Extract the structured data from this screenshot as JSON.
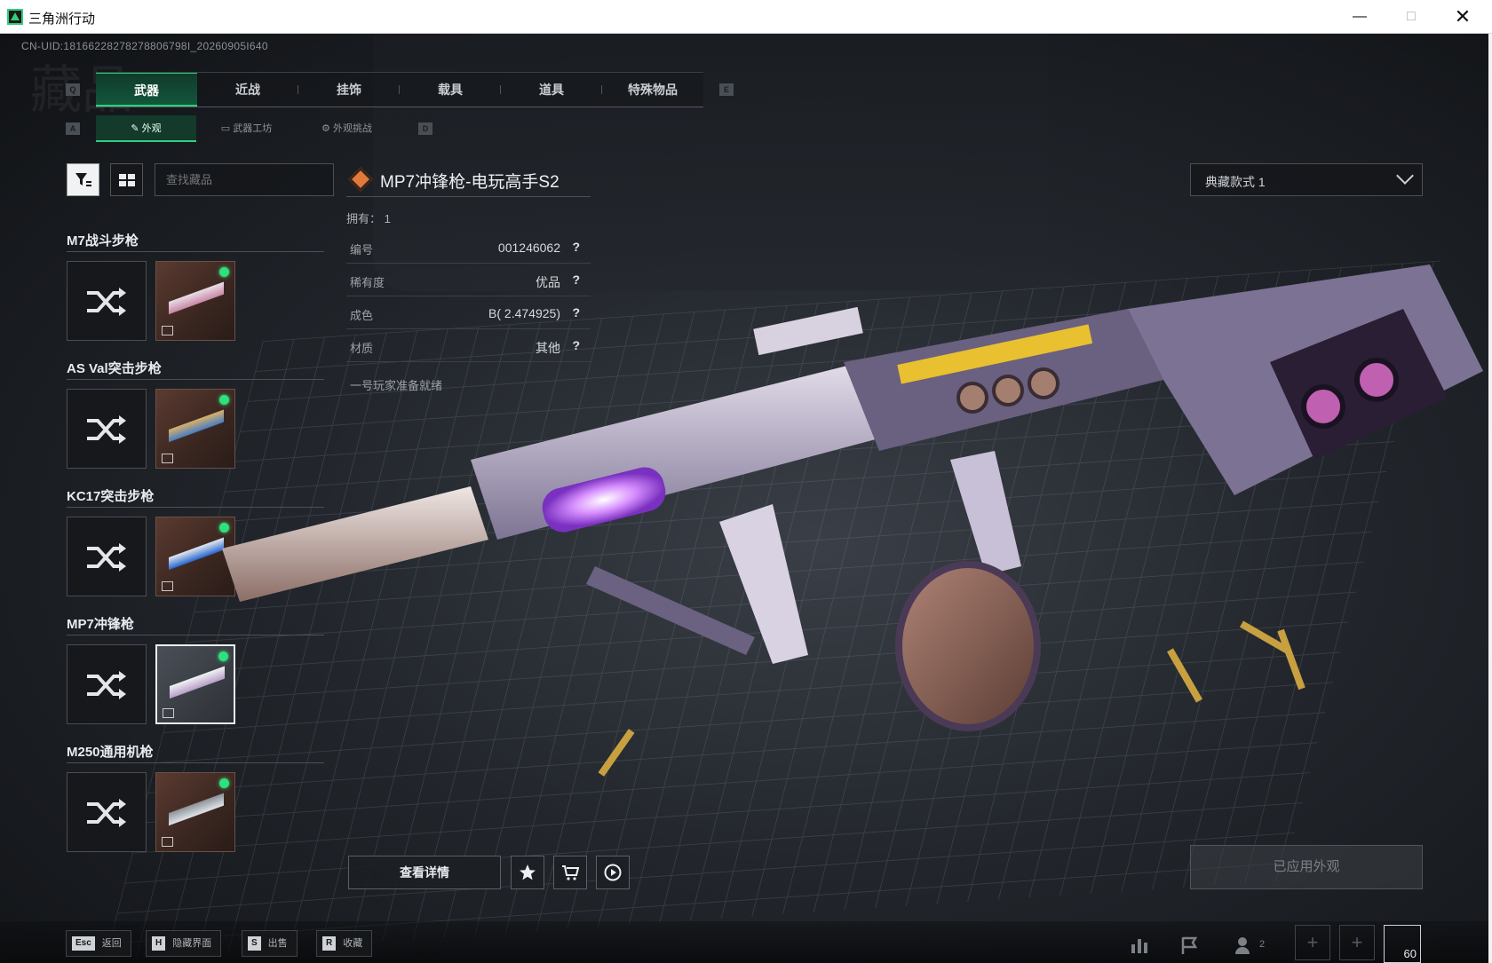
{
  "window": {
    "title": "三角洲行动",
    "minimize": "—",
    "maximize": "□",
    "close": "✕"
  },
  "uid_text": "CN-UID:18166228278278806798I_20260905I640",
  "bg_word": "藏品",
  "hotkeys": {
    "q": "Q",
    "e": "E",
    "a": "A",
    "d": "D"
  },
  "main_tabs": [
    {
      "label": "武器",
      "active": true
    },
    {
      "label": "近战",
      "active": false
    },
    {
      "label": "挂饰",
      "active": false
    },
    {
      "label": "载具",
      "active": false
    },
    {
      "label": "道具",
      "active": false
    },
    {
      "label": "特殊物品",
      "active": false
    }
  ],
  "sub_tabs": [
    {
      "label": "外观",
      "active": true
    },
    {
      "label": "武器工坊",
      "active": false
    },
    {
      "label": "外观挑战",
      "active": false
    }
  ],
  "search": {
    "placeholder": "查找藏品"
  },
  "weapons": [
    {
      "title": "M7战斗步枪",
      "skin_colors": [
        "#c98aa8",
        "#e8dce4"
      ]
    },
    {
      "title": "AS Val突击步枪",
      "skin_colors": [
        "#4a7fc0",
        "#d8b06a"
      ]
    },
    {
      "title": "KC17突击步枪",
      "skin_colors": [
        "#2b6ad0",
        "#e0e6f0"
      ]
    },
    {
      "title": "MP7冲锋枪",
      "skin_colors": [
        "#b8a0c8",
        "#f0f0f4"
      ],
      "selected": true
    },
    {
      "title": "M250通用机枪",
      "skin_colors": [
        "#dfe3e8",
        "#8e949a"
      ]
    }
  ],
  "item": {
    "name": "MP7冲锋枪-电玩高手S2",
    "owned_label": "拥有：",
    "owned_value": "1",
    "stats": [
      {
        "label": "编号",
        "value": "001246062"
      },
      {
        "label": "稀有度",
        "value": "优品"
      },
      {
        "label": "成色",
        "value": "B( 2.474925)"
      },
      {
        "label": "材质",
        "value": "其他"
      }
    ],
    "help_glyph": "?",
    "motto": "一号玩家准备就绪"
  },
  "variant": {
    "selected": "典藏款式 1"
  },
  "actions": {
    "detail_label": "查看详情",
    "applied_label": "已应用外观"
  },
  "footer": {
    "hints": [
      {
        "key": "Esc",
        "label": "返回"
      },
      {
        "key": "H",
        "label": "隐藏界面"
      },
      {
        "key": "S",
        "label": "出售"
      },
      {
        "key": "R",
        "label": "收藏"
      }
    ],
    "squad_count": "2",
    "plus": "+",
    "fps": "60"
  },
  "colors": {
    "accent": "#2fd07a",
    "rarity": "#e07a3a"
  }
}
